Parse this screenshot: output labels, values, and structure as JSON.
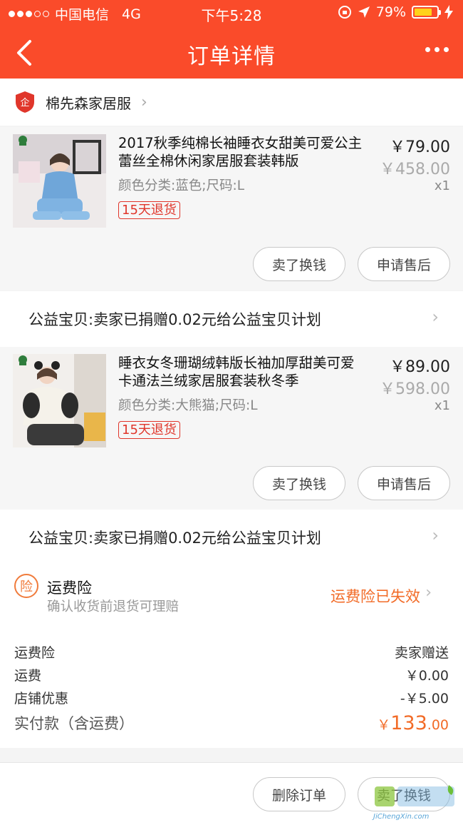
{
  "status_bar": {
    "carrier": "中国电信",
    "network": "4G",
    "time": "下午5:28",
    "battery": "79%",
    "battery_level": 0.79
  },
  "nav": {
    "title": "订单详情"
  },
  "shop": {
    "name": "棉先森家居服",
    "icon_text": "企"
  },
  "items": [
    {
      "name": "2017秋季纯棉长袖睡衣女甜美可爱公主蕾丝全棉休闲家居服套装韩版",
      "spec": "颜色分类:蓝色;尺码:L",
      "return_tag": "15天退货",
      "price": "￥79.00",
      "original_price": "￥458.00",
      "qty": "x1",
      "btn_sell": "卖了换钱",
      "btn_service": "申请售后"
    },
    {
      "name": "睡衣女冬珊瑚绒韩版长袖加厚甜美可爱卡通法兰绒家居服套装秋冬季",
      "spec": "颜色分类:大熊猫;尺码:L",
      "return_tag": "15天退货",
      "price": "￥89.00",
      "original_price": "￥598.00",
      "qty": "x1",
      "btn_sell": "卖了换钱",
      "btn_service": "申请售后"
    }
  ],
  "charity_text": "公益宝贝:卖家已捐赠0.02元给公益宝贝计划",
  "insurance": {
    "badge": "险",
    "title": "运费险",
    "subtitle": "确认收货前退货可理赔",
    "status": "运费险已失效"
  },
  "summary": {
    "rows": [
      {
        "label": "运费险",
        "value": "卖家赠送"
      },
      {
        "label": "运费",
        "value": "￥0.00"
      },
      {
        "label": "店铺优惠",
        "value": "-￥5.00"
      }
    ],
    "total_label": "实付款（含运费）",
    "total_currency": "￥",
    "total_int": "133",
    "total_dec": ".00"
  },
  "footer": {
    "delete_btn": "删除订单",
    "sell_btn": "卖了换钱"
  },
  "watermark": {
    "url": "JiChengXin.com"
  },
  "colors": {
    "header": "#fa4b2a",
    "accent_orange": "#f26b27",
    "tag_red": "#e0362b"
  }
}
